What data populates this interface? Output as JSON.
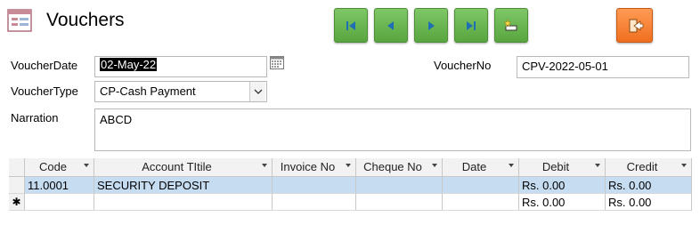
{
  "header": {
    "title": "Vouchers"
  },
  "nav": {
    "first_icon": "first-record-icon",
    "prev_icon": "previous-record-icon",
    "next_icon": "next-record-icon",
    "last_icon": "last-record-icon",
    "new_icon": "new-record-icon",
    "exit_icon": "exit-icon",
    "accent": "#58a63f",
    "exit_color": "#f06f1f"
  },
  "form": {
    "voucher_date_label": "VoucherDate",
    "voucher_date_value": "02-May-22",
    "voucher_no_label": "VoucherNo",
    "voucher_no_value": "CPV-2022-05-01",
    "voucher_type_label": "VoucherType",
    "voucher_type_value": "CP-Cash Payment",
    "narration_label": "Narration",
    "narration_value": "ABCD"
  },
  "grid": {
    "columns": [
      "Code",
      "Account TItile",
      "Invoice No",
      "Cheque No",
      "Date",
      "Debit",
      "Credit"
    ],
    "rows": [
      {
        "code": "11.0001",
        "account": "SECURITY DEPOSIT",
        "invoice": "",
        "cheque": "",
        "date": "",
        "debit": "Rs. 0.00",
        "credit": "Rs. 0.00"
      }
    ],
    "new_row": {
      "marker": "✱",
      "debit": "Rs. 0.00",
      "credit": "Rs. 0.00"
    }
  }
}
